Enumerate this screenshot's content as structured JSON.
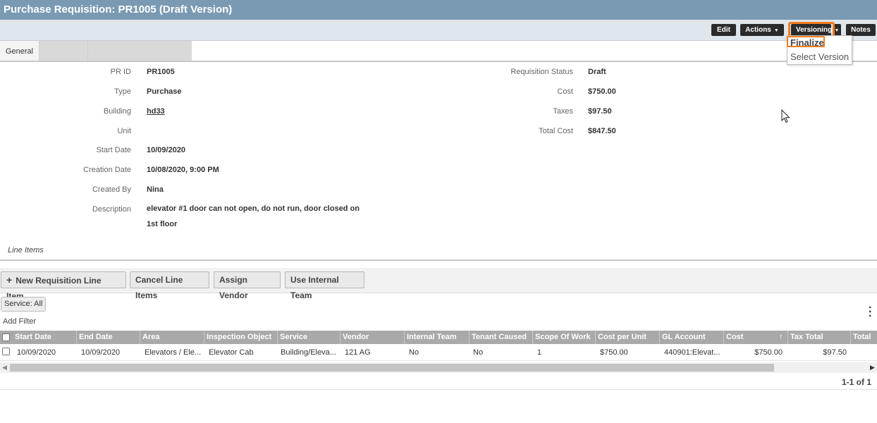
{
  "title": "Purchase Requisition: PR1005 (Draft Version)",
  "toolbar": {
    "edit": "Edit",
    "actions": "Actions",
    "versioning": "Versioning",
    "notes": "Notes"
  },
  "versioning_menu": {
    "items": [
      "Finalize",
      "Select Version"
    ]
  },
  "tabs": [
    "General",
    "",
    ""
  ],
  "details_left": [
    {
      "label": "PR ID",
      "value": "PR1005"
    },
    {
      "label": "Type",
      "value": "Purchase"
    },
    {
      "label": "Building",
      "value": "hd33"
    },
    {
      "label": "Unit",
      "value": ""
    },
    {
      "label": "Start Date",
      "value": "10/09/2020"
    },
    {
      "label": "Creation Date",
      "value": "10/08/2020, 9:00 PM"
    },
    {
      "label": "Created By",
      "value": "Nina"
    },
    {
      "label": "Description",
      "value": "elevator #1 door can not open, do not run, door closed on",
      "value2": "1st floor"
    }
  ],
  "details_right": [
    {
      "label": "Requisition Status",
      "value": "Draft"
    },
    {
      "label": "Cost",
      "value": "$750.00"
    },
    {
      "label": "Taxes",
      "value": "$97.50"
    },
    {
      "label": "Total Cost",
      "value": "$847.50"
    }
  ],
  "line_items": {
    "section_title": "Line Items",
    "buttons": {
      "new": "New Requisition Line Item",
      "cancel": "Cancel Line Items",
      "assign": "Assign Vendor",
      "internal": "Use Internal Team"
    },
    "filter_chip": "Service: All",
    "add_filter": "Add Filter",
    "columns": [
      "Start Date",
      "End Date",
      "Area",
      "Inspection Object",
      "Service",
      "Vendor",
      "Internal Team",
      "Tenant Caused",
      "Scope Of Work",
      "Cost per Unit",
      "GL Account",
      "Cost",
      "Tax Total",
      "Total"
    ],
    "rows": [
      [
        "10/09/2020",
        "10/09/2020",
        "Elevators / Ele...",
        "Elevator Cab",
        "Building/Eleva...",
        "121 AG",
        "No",
        "No",
        "1",
        "$750.00",
        "440901:Elevat...",
        "$750.00",
        "$97.50",
        ""
      ]
    ],
    "sort_indicator": "↑",
    "pager": "1-1 of 1"
  },
  "icons": {
    "plus": "plus-icon",
    "caret": "caret-down-icon",
    "kebab": "kebab-menu-icon",
    "cursor": "mouse-cursor-icon"
  },
  "colors": {
    "titlebar": "#7a9ab3",
    "highlight": "#f07c1e",
    "button_dark": "#2b2b2b"
  }
}
